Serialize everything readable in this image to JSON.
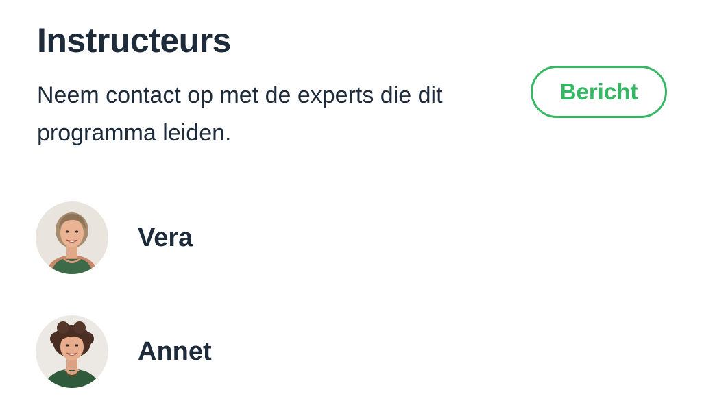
{
  "section": {
    "title": "Instructeurs",
    "description": "Neem contact op met de experts die dit programma leiden.",
    "message_button_label": "Bericht"
  },
  "instructors": [
    {
      "name": "Vera",
      "avatar_icon": "avatar-photo"
    },
    {
      "name": "Annet",
      "avatar_icon": "avatar-photo"
    }
  ],
  "colors": {
    "accent": "#35b864",
    "text": "#1e2b3a",
    "background": "#ffffff"
  }
}
